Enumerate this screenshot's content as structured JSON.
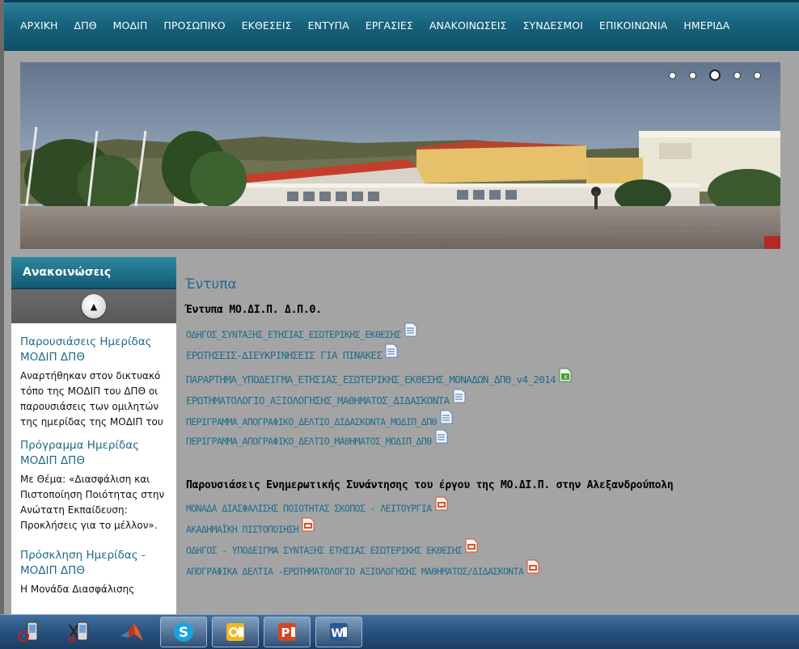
{
  "nav": {
    "items": [
      "ΑΡΧΙΚΗ",
      "ΔΠΘ",
      "ΜΟΔΙΠ",
      "ΠΡΟΣΩΠΙΚΟ",
      "ΕΚΘΕΣΕΙΣ",
      "ΕΝΤΥΠΑ",
      "ΕΡΓΑΣΙΕΣ",
      "ΑΝΑΚΟΙΝΩΣΕΙΣ",
      "ΣΥΝΔΕΣΜΟΙ",
      "ΕΠΙΚΟΙΝΩΝΙΑ",
      "ΗΜΕΡΙΔΑ"
    ]
  },
  "slider": {
    "dot_count": 5,
    "active_index": 2
  },
  "sidebar": {
    "title": "Ανακοινώσεις",
    "news": [
      {
        "title": "Παρουσιάσεις Ημερίδας ΜΟΔΙΠ ΔΠΘ",
        "text": "Αναρτήθηκαν στον δικτυακό τόπο της ΜΟΔΙΠ του ΔΠΘ οι παρουσιάσεις των ομιλητών της ημερίδας της ΜΟΔΙΠ του ΔΠΘ με θέμα: «Διασφάλιση"
      },
      {
        "title": "Πρόγραμμα Ημερίδας ΜΟΔΙΠ ΔΠΘ",
        "text": " Με Θέμα: «Διασφάλιση και Πιστοποίηση Ποιότητας στην Ανώτατη Εκπαίδευση: Προκλήσεις για το  μέλλον»."
      },
      {
        "title": "Πρόσκληση Ημερίδας - ΜΟΔΙΠ ΔΠΘ",
        "text": "Η Μονάδα Διασφάλισης"
      }
    ]
  },
  "main": {
    "page_title": "Έντυπα",
    "section1": {
      "title": "Έντυπα ΜΟ.ΔΙ.Π. Δ.Π.Θ.",
      "docs": [
        {
          "label": "ΟΔΗΓΟΣ_ΣΥΝΤΑΞΗΣ_ΕΤΗΣΙΑΣ_ΕΣΩΤΕΡΙΚΗΣ_ΕΚΘΕΣΗΣ",
          "icon": "word-doc-icon"
        },
        {
          "label": "ΕΡΩΤΗΣΕΙΣ-ΔΙΕΥΚΡΙΝΗΣΕΙΣ ΓΙΑ ΠΙΝΑΚΕΣ",
          "icon": "word-doc-icon"
        },
        {
          "label": "ΠΑΡΑΡΤΗΜΑ_ΥΠΟΔΕΙΓΜΑ_ΕΤΗΣΙΑΣ_ΕΣΩΤΕΡΙΚΗΣ_ΕΚΘΕΣΗΣ_ΜΟΝΑΔΩΝ_ΔΠΘ_v4_2014",
          "icon": "excel-doc-icon"
        },
        {
          "label": "ΕΡΩΤΗΜΑΤΟΛΟΓΙΟ_ΑΞΙΟΛΟΓΗΣΗΣ_ΜΑΘΗΜΑΤΟΣ_ΔΙΔΑΣΚΟΝΤΑ",
          "icon": "word-doc-icon"
        },
        {
          "label": "ΠΕΡΙΓΡΑΜΜΑ_ΑΠΟΓΡΑΦΙΚΟ_ΔΕΛΤΙΟ_ΔΙΔΑΣΚΟΝΤΑ_ΜΟΔΙΠ_ΔΠΘ",
          "icon": "word-doc-icon"
        },
        {
          "label": "ΠΕΡΙΓΡΑΜΜΑ_ΑΠΟΓΡΑΦΙΚΟ_ΔΕΛΤΙΟ_ΜΑΘΗΜΑΤΟΣ_ΜΟΔΙΠ_ΔΠΘ",
          "icon": "word-doc-icon"
        }
      ]
    },
    "section2": {
      "title": "Παρουσιάσεις Ενημερωτικής Συνάντησης του έργου της ΜΟ.ΔΙ.Π. στην Αλεξανδρούπολη",
      "docs": [
        {
          "label": "ΜΟΝΑΔΑ ΔΙΑΣΦΑΛΙΣΗΣ ΠΟΙΟΤΗΤΑΣ ΣΚΟΠΟΣ - ΛΕΙΤΟΥΡΓΙΑ",
          "icon": "powerpoint-doc-icon"
        },
        {
          "label": "ΑΚΑΔΗΜΑΪΚΗ ΠΙΣΤΟΠΟΙΗΣΗ",
          "icon": "powerpoint-doc-icon"
        },
        {
          "label": "ΟΔΗΓΟΣ - ΥΠΟΔΕΙΓΜΑ ΣΥΝΤΑΞΗΣ ΕΤΗΣΙΑΣ ΕΣΩΤΕΡΙΚΗΣ ΕΚΘΕΣΗΣ",
          "icon": "powerpoint-doc-icon"
        },
        {
          "label": "ΑΠΟΓΡΑΦΙΚΑ ΔΕΛΤΙΑ -ΕΡΩΤΗΜΑΤΟΛΟΓΙΟ ΑΞΙΟΛΟΓΗΣΗΣ ΜΑΘΗΜΑΤΟΣ/ΔΙΔΑΣΚΟΝΤΑ",
          "icon": "powerpoint-doc-icon"
        }
      ]
    }
  },
  "taskbar": {
    "items": [
      "device-sync-icon",
      "device-tools-icon",
      "matlab-icon",
      "skype-icon",
      "outlook-icon",
      "powerpoint-icon",
      "word-icon"
    ]
  },
  "colors": {
    "nav": "#17627c",
    "link": "#1f6d8b",
    "background": "#a4a4a4"
  }
}
